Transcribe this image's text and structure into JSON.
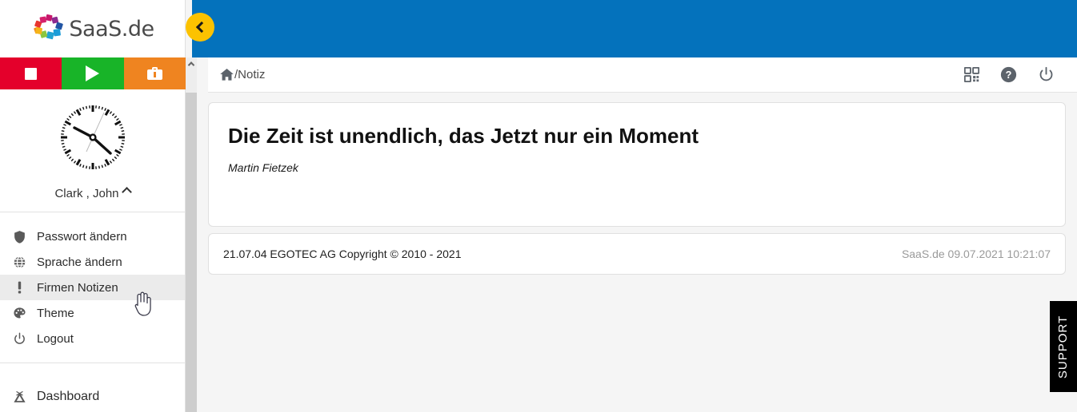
{
  "brand": {
    "logo_text": "SaaS.de",
    "logo_icon": "colored-ring-logo"
  },
  "colors": {
    "topbar_blue": "#0472bc",
    "collapse_yellow": "#fcc200",
    "stop_red": "#e4002b",
    "play_green": "#18b428",
    "case_orange": "#ef8420",
    "support_black": "#000000",
    "hover_grey": "#ebebeb"
  },
  "sidebar": {
    "actions": [
      {
        "name": "stop-button",
        "icon": "stop-square-icon",
        "color": "#e4002b"
      },
      {
        "name": "play-button",
        "icon": "play-triangle-icon",
        "color": "#18b428"
      },
      {
        "name": "briefcase-button",
        "icon": "briefcase-icon",
        "color": "#ef8420"
      }
    ],
    "clock": {
      "icon": "analog-clock",
      "hours": 10,
      "minutes": 21,
      "seconds": 7
    },
    "user_name": "Clark , John",
    "user_chevron": "chevron-up-icon",
    "items": [
      {
        "label": "Passwort ändern",
        "icon": "shield-icon",
        "hovered": false
      },
      {
        "label": "Sprache ändern",
        "icon": "globe-icon",
        "hovered": false
      },
      {
        "label": "Firmen Notizen",
        "icon": "exclamation-icon",
        "hovered": true
      },
      {
        "label": "Theme",
        "icon": "palette-icon",
        "hovered": false
      },
      {
        "label": "Logout",
        "icon": "power-icon",
        "hovered": false
      }
    ],
    "nav_items": [
      {
        "label": "Dashboard",
        "icon": "tent-icon"
      }
    ],
    "scrollbar": {
      "up_arrow": "chevron-up-icon"
    }
  },
  "header": {
    "collapse_button": {
      "icon": "chevron-left-icon"
    },
    "breadcrumb": {
      "home_icon": "home-icon",
      "path": "/Notiz"
    },
    "icons": [
      {
        "name": "qr-code-icon"
      },
      {
        "name": "help-icon"
      },
      {
        "name": "power-icon"
      }
    ]
  },
  "content": {
    "quote": {
      "part1": "Die ",
      "bold1": "Zeit",
      "part2": " ist unendlich, das ",
      "bold2": "Jetzt",
      "part3": " nur ein Moment",
      "author": "Martin Fietzek"
    },
    "footer": {
      "copyright": "21.07.04 EGOTEC AG Copyright © 2010 - 2021",
      "status": "SaaS.de  09.07.2021 10:21:07"
    }
  },
  "support": {
    "label": "SUPPORT"
  }
}
